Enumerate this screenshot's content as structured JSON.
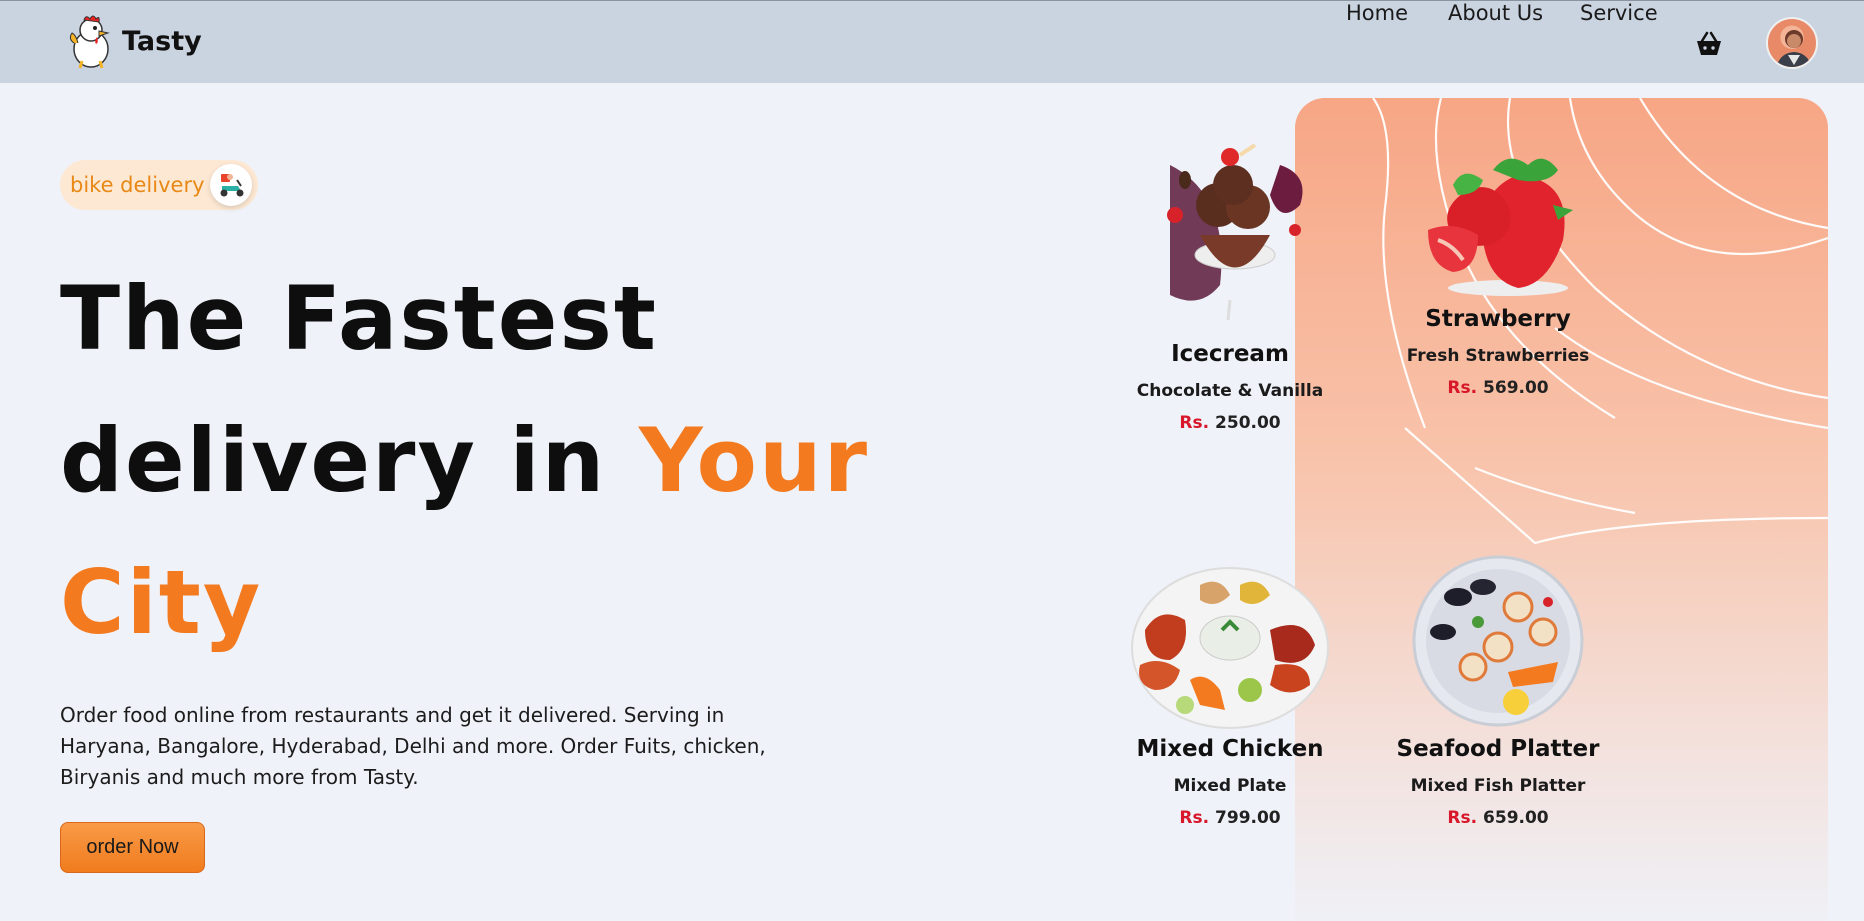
{
  "header": {
    "brand": "Tasty",
    "nav": [
      {
        "label": "Home"
      },
      {
        "label": "About Us"
      },
      {
        "label": "Service"
      }
    ]
  },
  "hero": {
    "badge": "bike delivery",
    "headline_line1": "The Fastest",
    "headline_line2_a": "delivery in ",
    "headline_line2_b": "Your",
    "headline_line3": "City",
    "description": "Order food online from restaurants and get it delivered. Serving in Haryana, Bangalore, Hyderabad, Delhi and more. Order Fuits, chicken, Biryanis and much more from Tasty.",
    "cta": "order Now"
  },
  "menu": [
    {
      "name": "Icecream",
      "desc": "Chocolate & Vanilla",
      "currency": "Rs.",
      "price": "250.00"
    },
    {
      "name": "Strawberry",
      "desc": "Fresh Strawberries",
      "currency": "Rs.",
      "price": "569.00"
    },
    {
      "name": "Mixed Chicken",
      "desc": "Mixed Plate",
      "currency": "Rs.",
      "price": "799.00"
    },
    {
      "name": "Seafood Platter",
      "desc": "Mixed Fish Platter",
      "currency": "Rs.",
      "price": "659.00"
    }
  ],
  "colors": {
    "accent": "#f47a1f",
    "header_bg": "#cad3e0",
    "page_bg": "#eff2f8",
    "price_currency": "#d8172a"
  }
}
